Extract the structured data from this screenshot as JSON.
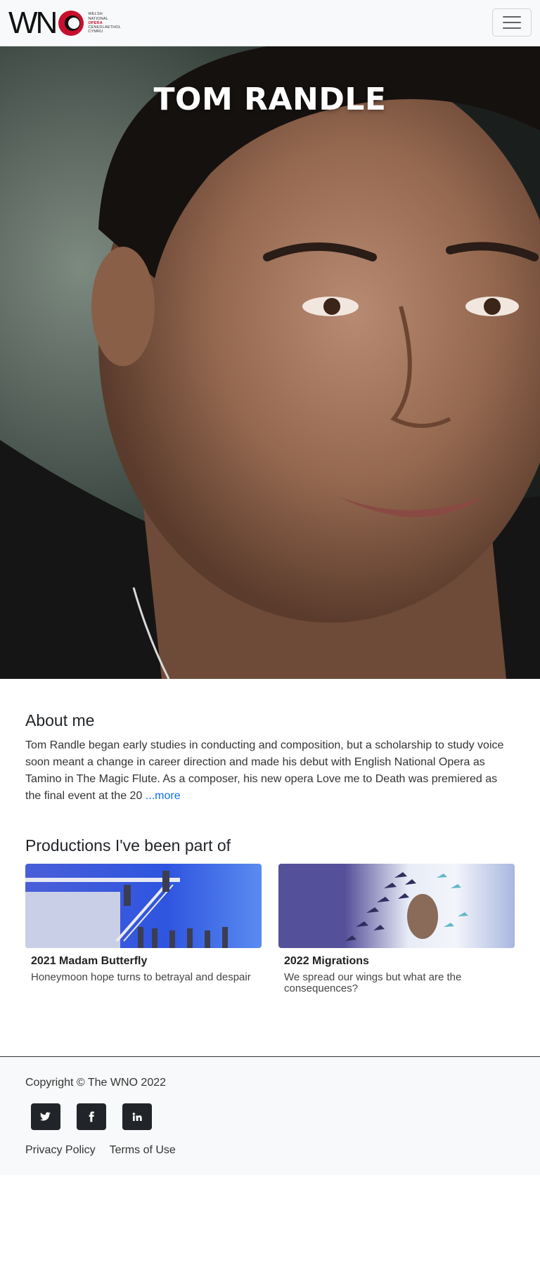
{
  "brand": {
    "letters": "WN",
    "tagline": [
      "WELSH",
      "NATIONAL",
      "OPERA",
      "CENEDLAETHOL",
      "CYMRU"
    ],
    "accent": "#c8102e"
  },
  "nav": {
    "toggle_icon": "hamburger-menu-icon"
  },
  "hero": {
    "title": "TOM RANDLE"
  },
  "about": {
    "heading": "About me",
    "text": "Tom Randle began early studies in conducting and composition, but a scholarship to study voice soon meant a change in career direction and made his debut with English National Opera as Tamino in The Magic Flute. As a composer, his new opera Love me to Death was premiered as the final event at the 20 ",
    "more_label": "...more"
  },
  "productions": {
    "heading": "Productions I've been part of",
    "items": [
      {
        "title": "2021 Madam Butterfly",
        "description": "Honeymoon hope turns to betrayal and despair"
      },
      {
        "title": "2022 Migrations",
        "description": "We spread our wings but what are the consequences?"
      }
    ]
  },
  "footer": {
    "copyright": "Copyright © The WNO 2022",
    "socials": [
      {
        "icon": "twitter-icon"
      },
      {
        "icon": "facebook-icon"
      },
      {
        "icon": "linkedin-icon"
      }
    ],
    "links": [
      "Privacy Policy",
      "Terms of Use"
    ]
  }
}
